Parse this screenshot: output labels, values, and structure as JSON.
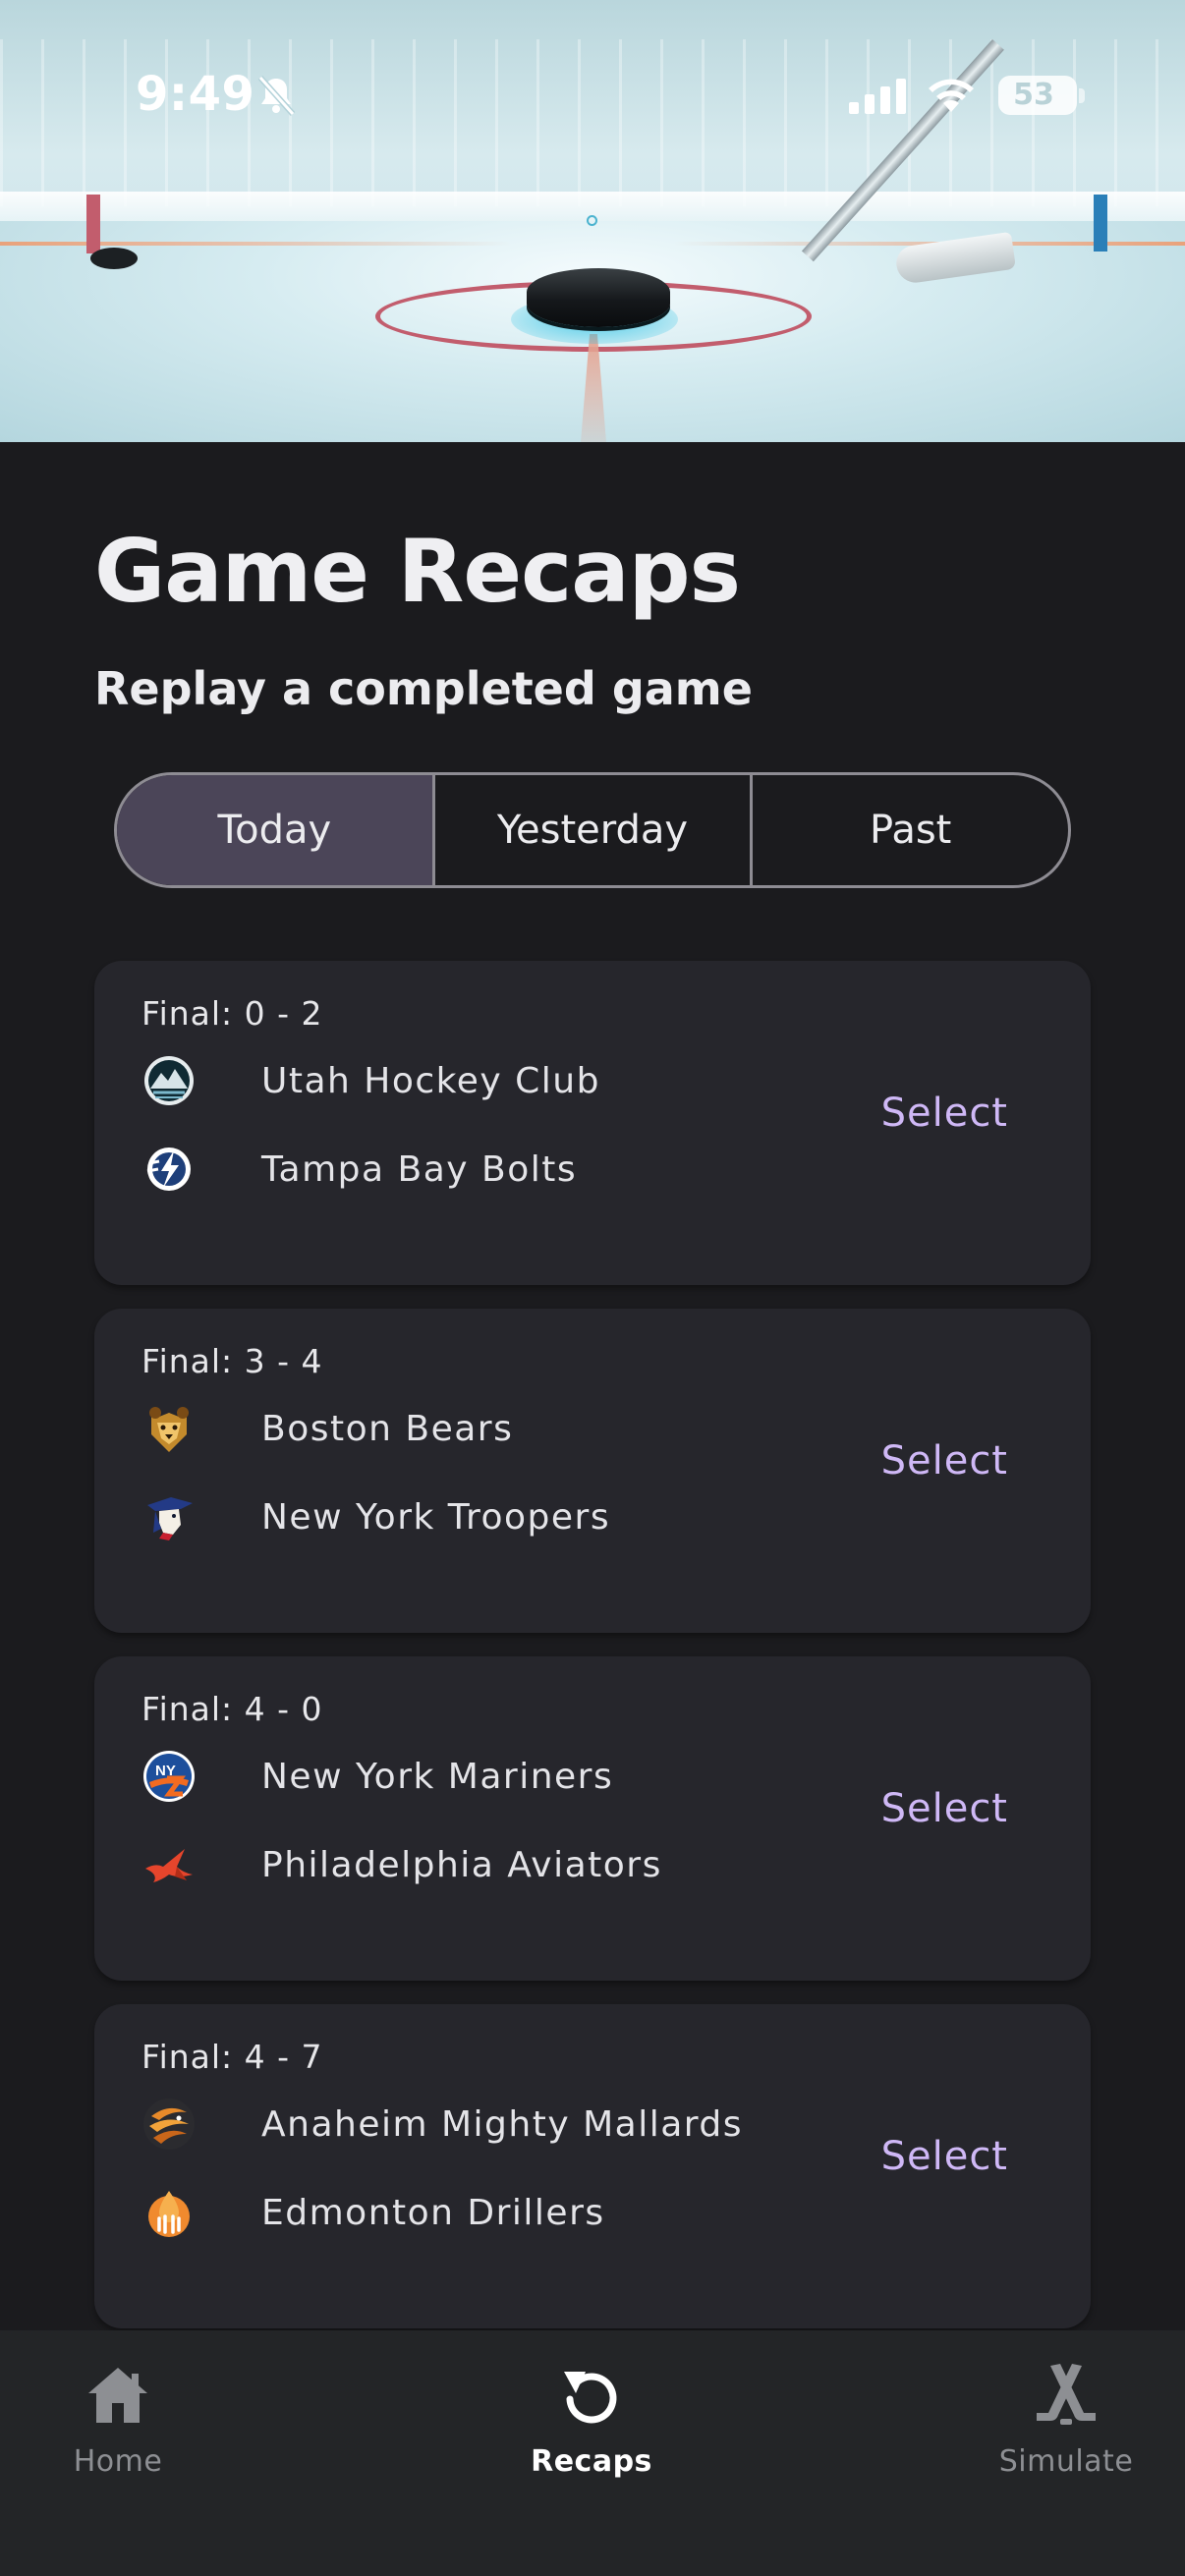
{
  "status_bar": {
    "time": "9:49",
    "battery": "53"
  },
  "header": {
    "title": "Game Recaps",
    "subtitle": "Replay a completed game"
  },
  "tabs": [
    {
      "label": "Today",
      "active": true
    },
    {
      "label": "Yesterday",
      "active": false
    },
    {
      "label": "Past",
      "active": false
    }
  ],
  "games": [
    {
      "final": "Final: 0 - 2",
      "home": {
        "name": "Utah Hockey Club",
        "logo": "mountain-logo-icon"
      },
      "away": {
        "name": "Tampa Bay Bolts",
        "logo": "lightning-logo-icon"
      },
      "action": "Select"
    },
    {
      "final": "Final: 3 - 4",
      "home": {
        "name": "Boston Bears",
        "logo": "bear-logo-icon"
      },
      "away": {
        "name": "New York Troopers",
        "logo": "trooper-logo-icon"
      },
      "action": "Select"
    },
    {
      "final": "Final: 4 - 0",
      "home": {
        "name": "New York Mariners",
        "logo": "mariners-logo-icon"
      },
      "away": {
        "name": "Philadelphia Aviators",
        "logo": "bird-logo-icon"
      },
      "action": "Select"
    },
    {
      "final": "Final: 4 - 7",
      "home": {
        "name": "Anaheim Mighty Mallards",
        "logo": "mallard-logo-icon"
      },
      "away": {
        "name": "Edmonton Drillers",
        "logo": "oil-drop-logo-icon"
      },
      "action": "Select"
    }
  ],
  "nav": [
    {
      "label": "Home",
      "icon": "home-icon",
      "active": false
    },
    {
      "label": "Recaps",
      "icon": "replay-icon",
      "active": true
    },
    {
      "label": "Simulate",
      "icon": "hockey-sticks-icon",
      "active": false
    }
  ],
  "colors": {
    "background": "#1b1b1e",
    "card": "#26262c",
    "accent": "#cfb8f6",
    "active_tab": "#4b4558",
    "nav_bar": "#232527"
  }
}
